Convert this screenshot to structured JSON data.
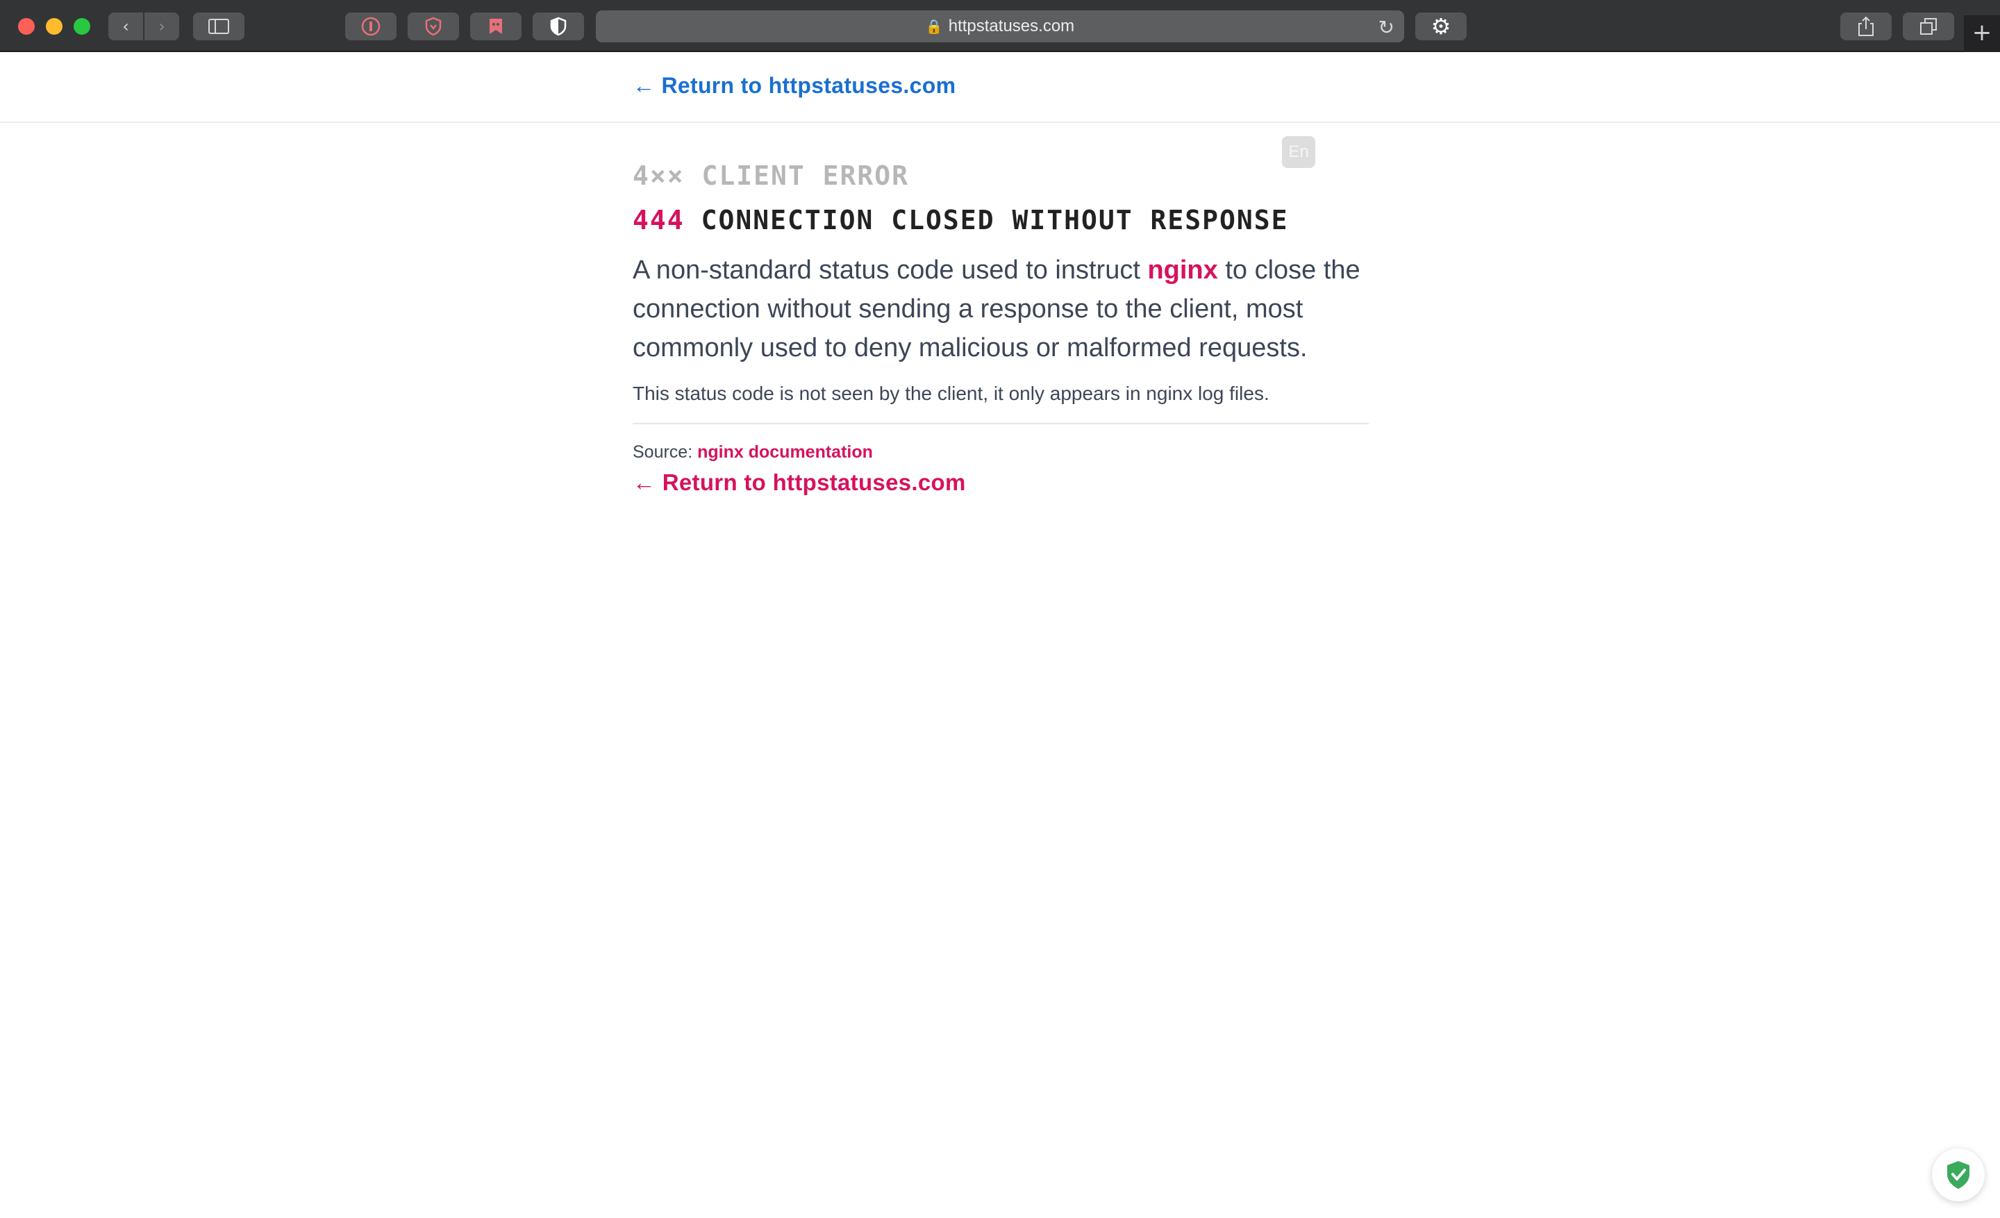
{
  "browser": {
    "url": "httpstatuses.com",
    "new_tab_label": "+"
  },
  "page": {
    "top_return_link": "← Return to httpstatuses.com",
    "language_badge": "En",
    "category": "4×× CLIENT ERROR",
    "status_code": "444",
    "status_name": "CONNECTION CLOSED WITHOUT RESPONSE",
    "description": {
      "before": "A non-standard status code used to instruct ",
      "highlight": "nginx",
      "after": " to close the connection without sending a response to the client, most commonly used to deny malicious or malformed requests."
    },
    "note": "This status code is not seen by the client, it only appears in nginx log files.",
    "source_label": "Source:",
    "source_link": "nginx documentation",
    "bottom_return_link": "← Return to httpstatuses.com"
  }
}
